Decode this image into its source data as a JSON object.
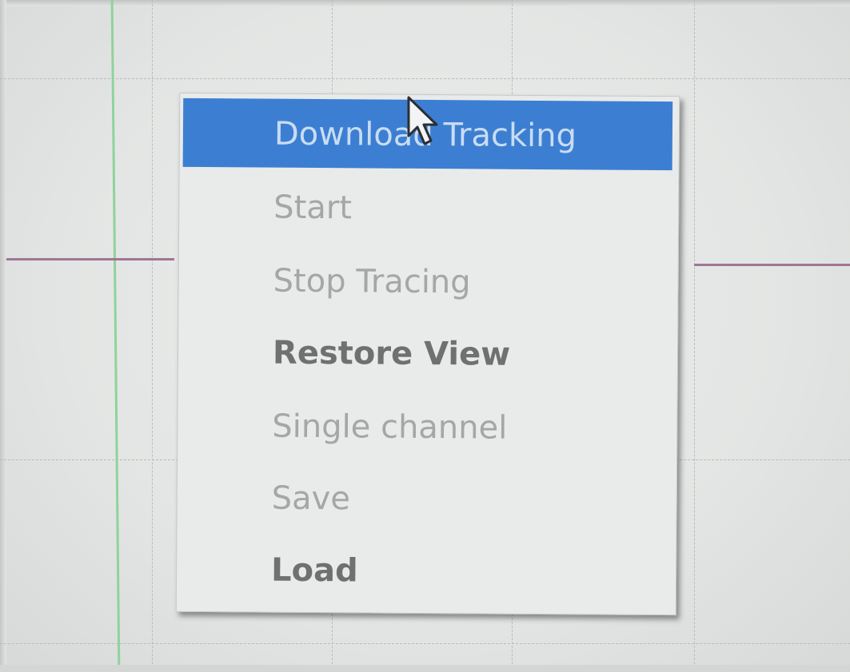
{
  "context_menu": {
    "items": [
      {
        "label": "Download Tracking",
        "state": "highlighted"
      },
      {
        "label": "Start",
        "state": "disabled"
      },
      {
        "label": "Stop Tracing",
        "state": "disabled"
      },
      {
        "label": "Restore View",
        "state": "enabled"
      },
      {
        "label": "Single channel",
        "state": "disabled"
      },
      {
        "label": "Save",
        "state": "disabled"
      },
      {
        "label": "Load",
        "state": "enabled"
      }
    ]
  },
  "colors": {
    "highlight": "#3c7fd2",
    "trace": "#a07695",
    "cursor_line": "#8fd39a"
  },
  "icons": {
    "pointer": "mouse-pointer-icon"
  }
}
